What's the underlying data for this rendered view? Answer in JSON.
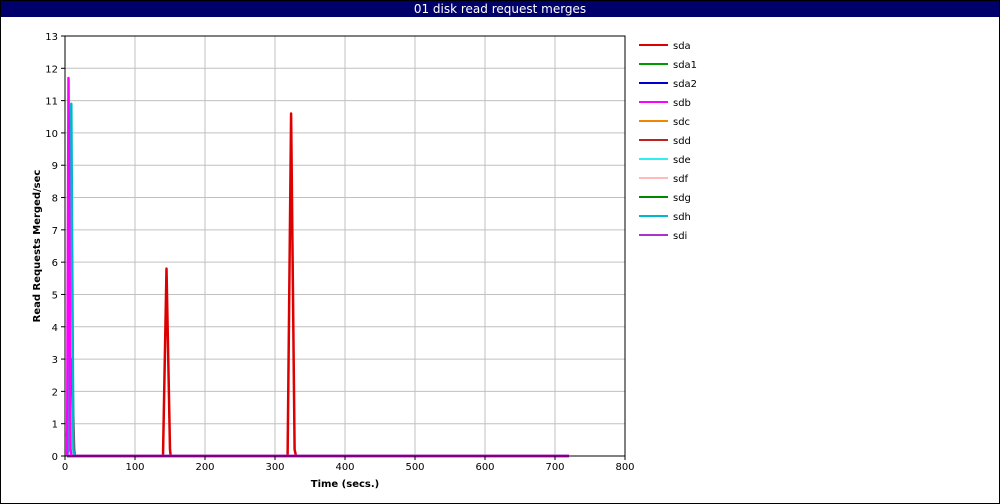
{
  "window": {
    "title": "01 disk read request merges"
  },
  "chart_data": {
    "type": "line",
    "title": "01 disk read request merges",
    "xlabel": "Time (secs.)",
    "ylabel": "Read Requests Merged/sec",
    "xlim": [
      0,
      800
    ],
    "ylim": [
      0,
      13
    ],
    "xticks": [
      0,
      100,
      200,
      300,
      400,
      500,
      600,
      700,
      800
    ],
    "yticks": [
      0,
      1,
      2,
      3,
      4,
      5,
      6,
      7,
      8,
      9,
      10,
      11,
      12,
      13
    ],
    "grid": true,
    "legend_position": "right",
    "series": [
      {
        "name": "sda",
        "color": "#dd0000",
        "x": [
          3,
          5,
          10,
          13,
          14,
          140,
          145,
          150,
          151,
          318,
          323,
          328,
          330,
          720
        ],
        "y": [
          0.6,
          2.0,
          3.0,
          0.2,
          0,
          0,
          5.8,
          0.2,
          0,
          0,
          10.6,
          0.2,
          0,
          0
        ]
      },
      {
        "name": "sda1",
        "color": "#009900",
        "x": [
          3,
          720
        ],
        "y": [
          0,
          0
        ]
      },
      {
        "name": "sda2",
        "color": "#0000cc",
        "x": [
          3,
          720
        ],
        "y": [
          0,
          0
        ]
      },
      {
        "name": "sdb",
        "color": "#ff00ff",
        "x": [
          3,
          5,
          8,
          9,
          720
        ],
        "y": [
          0,
          11.7,
          0.2,
          0,
          0
        ]
      },
      {
        "name": "sdc",
        "color": "#ee8800",
        "x": [
          3,
          720
        ],
        "y": [
          0,
          0
        ]
      },
      {
        "name": "sdd",
        "color": "#bb2222",
        "x": [
          3,
          720
        ],
        "y": [
          0,
          0
        ]
      },
      {
        "name": "sde",
        "color": "#33eeee",
        "x": [
          3,
          720
        ],
        "y": [
          0,
          0
        ]
      },
      {
        "name": "sdf",
        "color": "#ffbbbb",
        "x": [
          3,
          720
        ],
        "y": [
          0,
          0
        ]
      },
      {
        "name": "sdg",
        "color": "#008800",
        "x": [
          3,
          720
        ],
        "y": [
          0,
          0
        ]
      },
      {
        "name": "sdh",
        "color": "#00b8cc",
        "x": [
          3,
          6,
          9,
          12,
          13,
          720
        ],
        "y": [
          0,
          0.3,
          10.9,
          0.2,
          0,
          0
        ]
      },
      {
        "name": "sdi",
        "color": "#aa33cc",
        "x": [
          3,
          720
        ],
        "y": [
          0,
          0
        ]
      }
    ]
  }
}
